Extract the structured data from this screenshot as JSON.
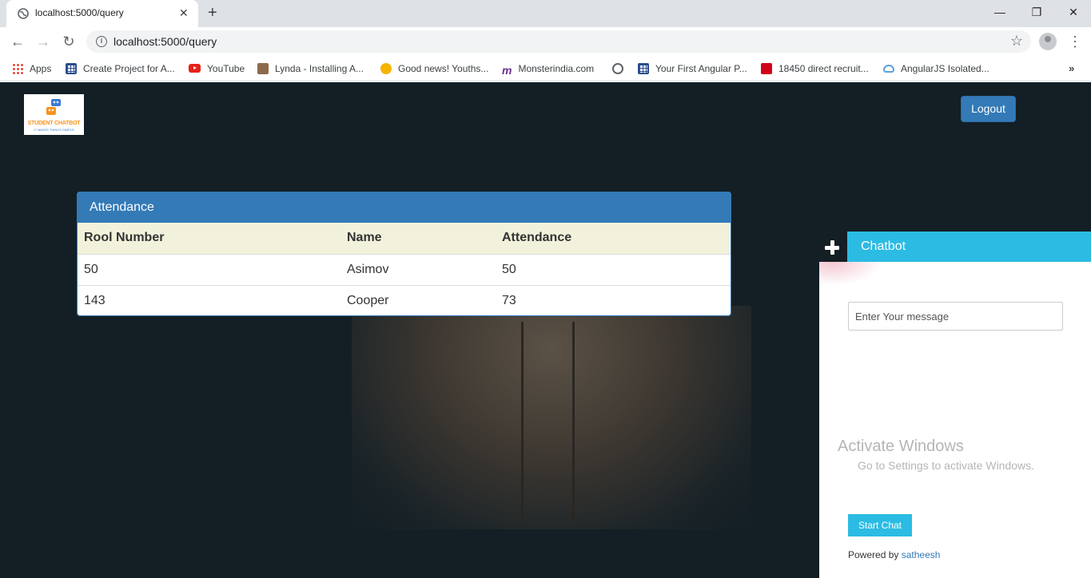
{
  "browser": {
    "tab_title": "localhost:5000/query",
    "tab_close": "✕",
    "new_tab": "+",
    "window_controls": {
      "minimize": "—",
      "maximize": "❐",
      "close": "✕"
    },
    "url": "localhost:5000/query",
    "bookmarks": [
      {
        "label": "Apps",
        "icon": "apps-grid-icon"
      },
      {
        "label": "Create Project for A...",
        "icon": "grid-icon"
      },
      {
        "label": "YouTube",
        "icon": "youtube-icon"
      },
      {
        "label": "Lynda - Installing A...",
        "icon": "lynda-icon"
      },
      {
        "label": "Good news! Youths...",
        "icon": "news-icon"
      },
      {
        "label": "Monsterindia.com",
        "icon": "monster-icon"
      },
      {
        "label": "",
        "icon": "globe-icon"
      },
      {
        "label": "Your First Angular P...",
        "icon": "grid-icon"
      },
      {
        "label": "18450 direct recruit...",
        "icon": "toi-icon"
      },
      {
        "label": "AngularJS Isolated...",
        "icon": "cloud-icon"
      }
    ],
    "bookmark_more": "»"
  },
  "logo": {
    "title": "STUDENT CHATBOT",
    "tagline": "IT MAKES THINGS SIMPLE"
  },
  "header": {
    "logout_label": "Logout"
  },
  "attendance": {
    "title": "Attendance",
    "columns": [
      "Rool Number",
      "Name",
      "Attendance"
    ],
    "rows": [
      [
        "50",
        "Asimov",
        "50"
      ],
      [
        "143",
        "Cooper",
        "73"
      ]
    ]
  },
  "chatbot": {
    "title": "Chatbot",
    "input_placeholder": "Enter Your message",
    "start_label": "Start Chat",
    "powered_prefix": "Powered by",
    "powered_link": "satheesh"
  },
  "watermark": {
    "title": "Activate Windows",
    "subtitle": "Go to Settings to activate Windows."
  },
  "colors": {
    "primary": "#337ab7",
    "chat_accent": "#2bbbe3",
    "page_background": "#131f25",
    "table_header_bg": "#f2f2dc"
  }
}
